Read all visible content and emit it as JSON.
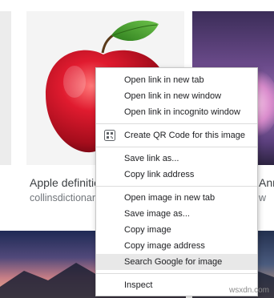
{
  "results": [
    {
      "title": "Apple definitio",
      "source": "collinsdictionar"
    },
    {
      "title": "Ann",
      "source": "w"
    }
  ],
  "context_menu": {
    "groups": [
      [
        "Open link in new tab",
        "Open link in new window",
        "Open link in incognito window"
      ],
      [
        "Create QR Code for this image"
      ],
      [
        "Save link as...",
        "Copy link address"
      ],
      [
        "Open image in new tab",
        "Save image as...",
        "Copy image",
        "Copy image address",
        "Search Google for image"
      ],
      [
        "Inspect"
      ]
    ],
    "highlighted": "Search Google for image"
  },
  "watermark": "wsxdn.com",
  "icons": {
    "qr": "qr-code-icon"
  },
  "colors": {
    "highlight": "#e8e8e8",
    "menu_border": "#c8c8c8",
    "apple_red": "#c8102e",
    "leaf_green": "#3f9a2a"
  }
}
